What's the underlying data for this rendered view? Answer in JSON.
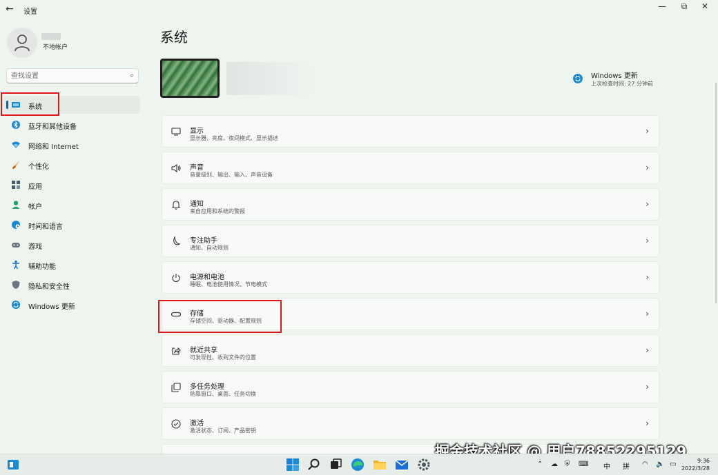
{
  "window": {
    "title": "设置",
    "back": "←",
    "min": "—",
    "max": "⧉",
    "close": "✕"
  },
  "user": {
    "name": "不地帐户"
  },
  "search": {
    "placeholder": "查找设置"
  },
  "nav": [
    {
      "label": "系统",
      "icon": "monitor-icon"
    },
    {
      "label": "蓝牙和其他设备",
      "icon": "bluetooth-icon"
    },
    {
      "label": "网络和 Internet",
      "icon": "wifi-icon"
    },
    {
      "label": "个性化",
      "icon": "brush-icon"
    },
    {
      "label": "应用",
      "icon": "apps-icon"
    },
    {
      "label": "帐户",
      "icon": "person-icon"
    },
    {
      "label": "时间和语言",
      "icon": "globe-clock-icon"
    },
    {
      "label": "游戏",
      "icon": "gamepad-icon"
    },
    {
      "label": "辅助功能",
      "icon": "accessibility-icon"
    },
    {
      "label": "隐私和安全性",
      "icon": "shield-icon"
    },
    {
      "label": "Windows 更新",
      "icon": "update-icon"
    }
  ],
  "page_title": "系统",
  "windows_update": {
    "title": "Windows 更新",
    "subtitle": "上次检查时间: 27 分钟前"
  },
  "cards": [
    {
      "title": "显示",
      "subtitle": "显示器、亮度、夜间模式、显示描述",
      "icon": "display-icon"
    },
    {
      "title": "声音",
      "subtitle": "音量级别、输出、输入、声音设备",
      "icon": "speaker-icon"
    },
    {
      "title": "通知",
      "subtitle": "来自应用和系统的警报",
      "icon": "bell-icon"
    },
    {
      "title": "专注助手",
      "subtitle": "通知、自动规则",
      "icon": "moon-icon"
    },
    {
      "title": "电源和电池",
      "subtitle": "睡眠、电池使用情况、节电模式",
      "icon": "power-icon"
    },
    {
      "title": "存储",
      "subtitle": "存储空间、驱动器、配置规则",
      "icon": "storage-icon"
    },
    {
      "title": "就近共享",
      "subtitle": "可发现性、收到文件的位置",
      "icon": "share-icon"
    },
    {
      "title": "多任务处理",
      "subtitle": "贴靠窗口、桌面、任务切换",
      "icon": "multitask-icon"
    },
    {
      "title": "激活",
      "subtitle": "激活状态、订阅、产品密钥",
      "icon": "check-circle-icon"
    }
  ],
  "taskbar": {
    "ime_lang": "中",
    "ime_mode": "拼",
    "time": "9:36",
    "date": "2022/3/28"
  },
  "watermark": "掘金技术社区 @ 用户7885229512​9"
}
